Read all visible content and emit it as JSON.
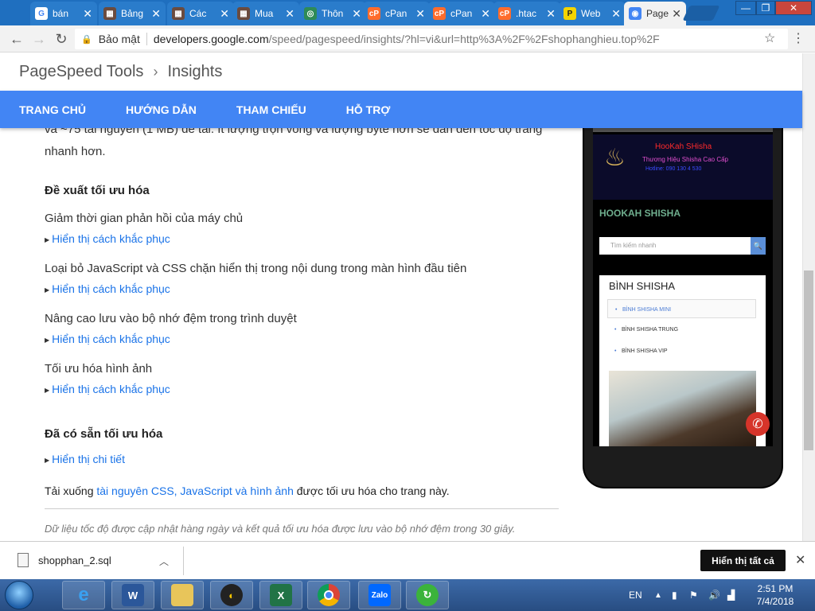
{
  "browser": {
    "tabs": [
      {
        "favicon": "G",
        "favcolor": "#ffffff",
        "label": "bán"
      },
      {
        "favicon": "▦",
        "favcolor": "#6b4b3e",
        "label": "Bảng"
      },
      {
        "favicon": "▦",
        "favcolor": "#6b4b3e",
        "label": "Các"
      },
      {
        "favicon": "▦",
        "favcolor": "#6b4b3e",
        "label": "Mua"
      },
      {
        "favicon": "◎",
        "favcolor": "#2e8b57",
        "label": "Thôn"
      },
      {
        "favicon": "cP",
        "favcolor": "#ff6c2c",
        "label": "cPan"
      },
      {
        "favicon": "cP",
        "favcolor": "#ff6c2c",
        "label": "cPan"
      },
      {
        "favicon": "cP",
        "favcolor": "#ff6c2c",
        "label": ".htac"
      },
      {
        "favicon": "P",
        "favcolor": "#f4d400",
        "label": "Web"
      },
      {
        "favicon": "◉",
        "favcolor": "#4285f4",
        "label": "Page"
      }
    ],
    "address": {
      "secure_label": "Bảo mật",
      "host": "developers.google.com",
      "path": "/speed/pagespeed/insights/?hl=vi&url=http%3A%2F%2Fshophanghieu.top%2F"
    }
  },
  "page": {
    "breadcrumb": {
      "root": "PageSpeed Tools",
      "current": "Insights"
    },
    "nav": [
      "TRANG CHỦ",
      "HƯỚNG DẪN",
      "THAM CHIẾU",
      "HỖ TRỢ"
    ],
    "intro_cut": "và ~75 tài nguyên (1 MB) để tải. Ít lượng trọn vòng và lượng byte hơn sẽ dẫn đến tốc độ trang nhanh hơn.",
    "suggest_heading": "Đề xuất tối ưu hóa",
    "rules": [
      {
        "title": "Giảm thời gian phản hồi của máy chủ",
        "link": "Hiển thị cách khắc phục"
      },
      {
        "title": "Loại bỏ JavaScript và CSS chặn hiển thị trong nội dung trong màn hình đầu tiên",
        "link": "Hiển thị cách khắc phục"
      },
      {
        "title": "Nâng cao lưu vào bộ nhớ đệm trong trình duyệt",
        "link": "Hiển thị cách khắc phục"
      },
      {
        "title": "Tối ưu hóa hình ảnh",
        "link": "Hiển thị cách khắc phục"
      }
    ],
    "done_heading": "Đã có sẵn tối ưu hóa",
    "done_link": "Hiển thị chi tiết",
    "download": {
      "prefix": "Tải xuống ",
      "link": "tài nguyên CSS, JavaScript và hình ảnh",
      "suffix": " được tối ưu hóa cho trang này."
    },
    "footnote": "Dữ liệu tốc độ được cập nhật hàng ngày và kết quả tối ưu hóa được lưu vào bộ nhớ đệm trong 30 giây."
  },
  "preview": {
    "banner_title": "HooKah SHisha",
    "banner_sub": "Thương Hiệu Shisha Cao Cấp",
    "banner_phone": "Hotline: 090 130 4 530",
    "site_title": "HOOKAH SHISHA",
    "search_placeholder": "Tìm kiếm nhanh",
    "panel_heading": "BÌNH SHISHA",
    "panel_items": [
      "BÌNH SHISHA MINI",
      "BÌNH SHISHA TRUNG",
      "BÌNH SHISHA VIP"
    ]
  },
  "downloads": {
    "file": "shopphan_2.sql",
    "show_all": "Hiển thị tất cả"
  },
  "taskbar": {
    "lang": "EN",
    "time": "2:51 PM",
    "date": "7/4/2018"
  }
}
